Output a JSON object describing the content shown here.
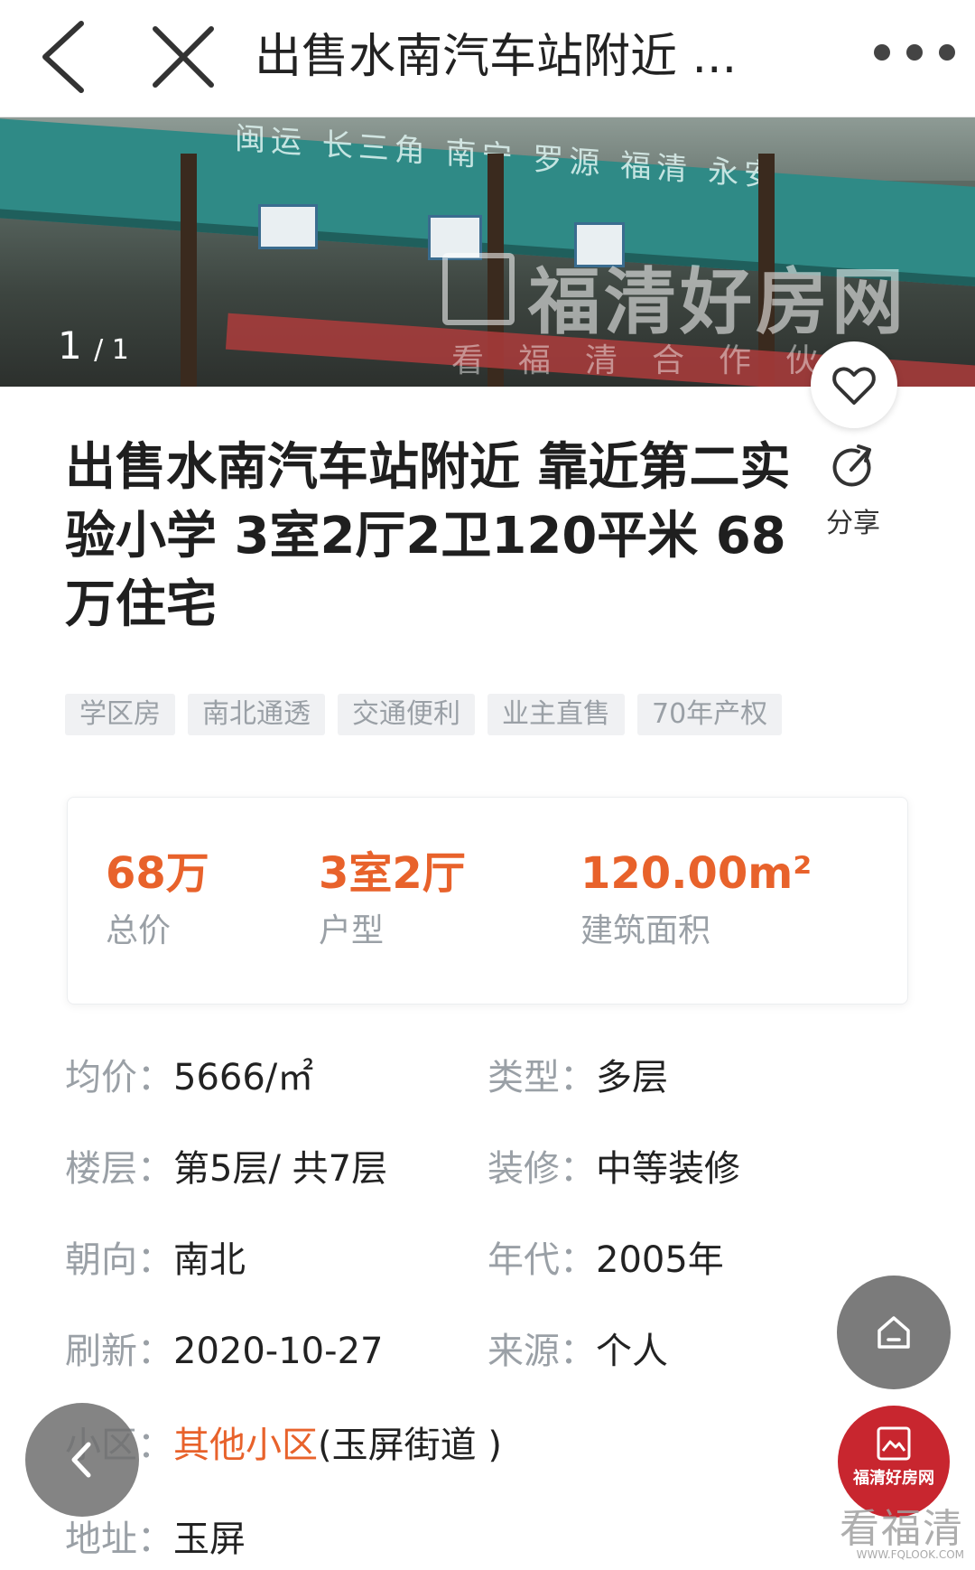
{
  "nav": {
    "title": "出售水南汽车站附近 ..."
  },
  "gallery": {
    "watermark_title": "福清好房网",
    "watermark_subtitle": "看福清合作伙",
    "canopy_text": "闽运 长三角 南宁 罗源 福清 永安",
    "counter_current": "1",
    "counter_total": "/ 1"
  },
  "listing": {
    "title": "出售水南汽车站附近 靠近第二实验小学 3室2厅2卫120平米 68万住宅",
    "share_label": "分享",
    "tags": [
      "学区房",
      "南北通透",
      "交通便利",
      "业主直售",
      "70年产权"
    ]
  },
  "key_facts": [
    {
      "value": "68万",
      "label": "总价"
    },
    {
      "value": "3室2厅",
      "label": "户型"
    },
    {
      "value": "120.00m²",
      "label": "建筑面积"
    }
  ],
  "details": {
    "avg_price": {
      "key": "均价：",
      "value": "5666/㎡"
    },
    "type": {
      "key": "类型：",
      "value": "多层"
    },
    "floor": {
      "key": "楼层：",
      "value": "第5层/ 共7层"
    },
    "decoration": {
      "key": "装修：",
      "value": "中等装修"
    },
    "orientation": {
      "key": "朝向：",
      "value": "南北"
    },
    "year": {
      "key": "年代：",
      "value": "2005年"
    },
    "refresh": {
      "key": "刷新：",
      "value": "2020-10-27"
    },
    "source": {
      "key": "来源：",
      "value": "个人"
    },
    "community": {
      "key": "小区：",
      "link": "其他小区",
      "extra": "(玉屏街道 )"
    },
    "address": {
      "key": "地址：",
      "value": "玉屏"
    }
  },
  "brand": {
    "badge_name": "福清好房网",
    "corner_mark": "看福清",
    "corner_url": "WWW.FQLOOK.COM"
  },
  "colors": {
    "accent": "#e8622b",
    "tag_bg": "#f0f1f3",
    "badge_red": "#c8262f"
  }
}
